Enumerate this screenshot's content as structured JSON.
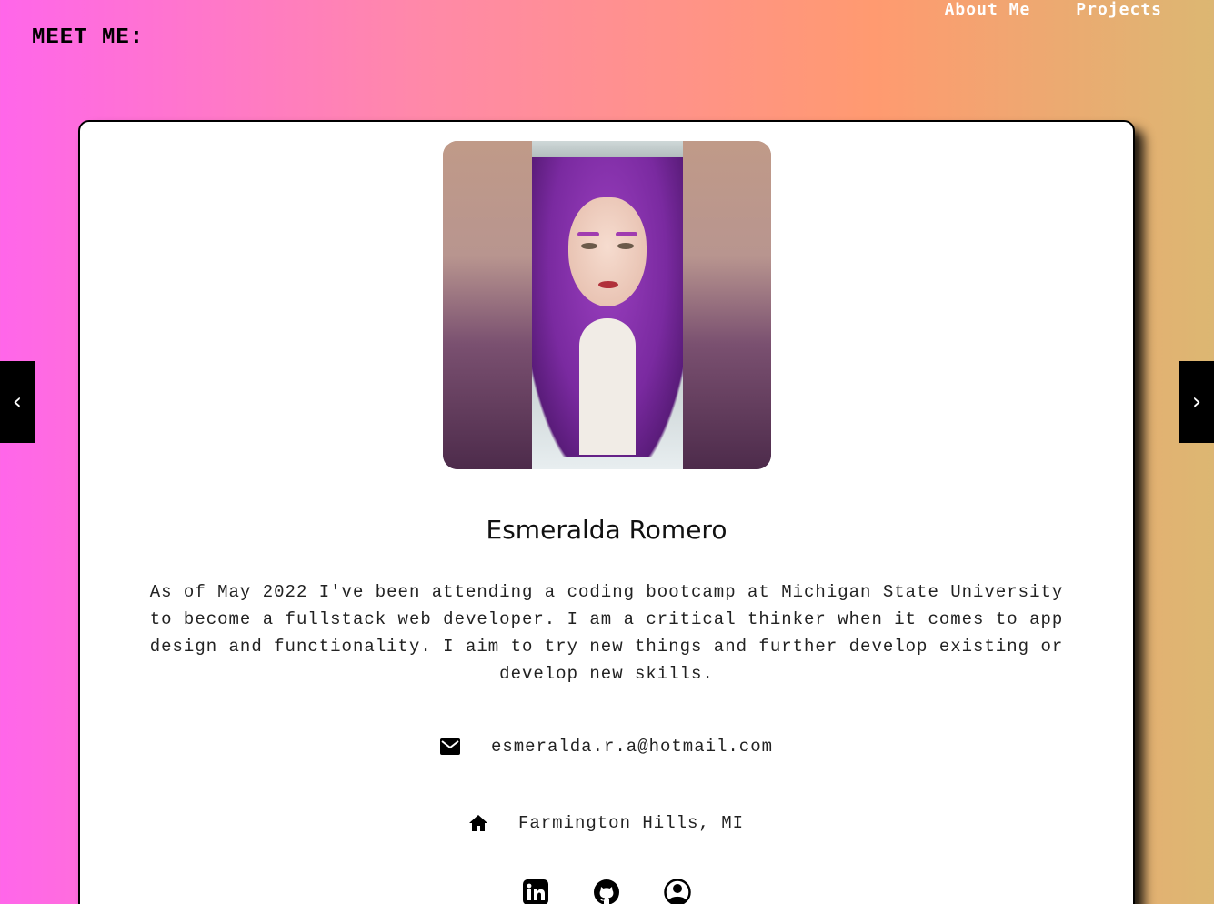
{
  "header": {
    "page_label": "MEET ME:",
    "nav": [
      {
        "label": "About Me"
      },
      {
        "label": "Projects"
      }
    ]
  },
  "profile": {
    "name": "Esmeralda Romero",
    "bio": "As of May 2022 I've been attending a coding bootcamp at Michigan State University to become a fullstack web developer. I am a critical thinker when it comes to app design and functionality. I aim to try new things and further develop existing or develop new skills.",
    "email": "esmeralda.r.a@hotmail.com",
    "location": "Farmington Hills, MI",
    "photo_icon": "profile-photo"
  },
  "carousel": {
    "prev_label": "‹",
    "next_label": "›"
  },
  "socials": [
    {
      "icon": "linkedin-icon"
    },
    {
      "icon": "github-icon"
    },
    {
      "icon": "user-circle-icon"
    }
  ]
}
